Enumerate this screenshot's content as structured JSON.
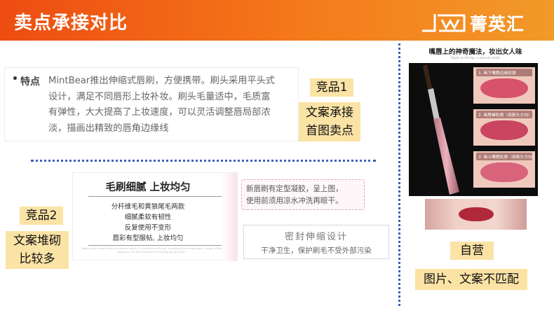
{
  "header": {
    "title": "卖点承接对比",
    "logo_text": "菁英汇",
    "accent": "#f06a18"
  },
  "competitor1": {
    "bullet": "•",
    "feature_label": "特点",
    "feature_lines": [
      "MintBear推出伸缩式唇刷，方便携带。刷头采用平头式",
      "设计，满足不同唇形上妆补妆。刷头毛量适中，毛质富",
      "有弹性，大大提高了上妆速度，可以灵活调整唇局部浓",
      "淡，描画出精致的唇角边缘线"
    ],
    "tag_name": "竞品1",
    "tag_desc_lines": [
      "文案承接",
      "首图卖点"
    ]
  },
  "competitor2": {
    "tag_name": "竞品2",
    "tag_desc_lines": [
      "文案堆砌",
      "比较多"
    ],
    "card_title": "毛刷细腻 上妆均匀",
    "card_items": [
      "分杆维毛和黄狼尾毛两款",
      "细腻柔软有韧性",
      "反复使用不变形",
      "唇彩有型服帖, 上妆均匀"
    ],
    "card_small_text": "Tooth is not a time of life or a state of mind; it is a tenure of the will, a quality of the imagination, a vigor of the emotions. It is the freshness of the deep spring of life.",
    "note_lines": [
      "新唇刷有定型凝胶，呈上图，",
      "使用前须用凉水冲洗再晾干。"
    ],
    "seal_title": "密封伸缩设计",
    "seal_sub": "干净卫生，保护刷毛不受外部污染"
  },
  "self": {
    "product_title": "嘴唇上的神奇魔法，妆出女人味",
    "product_sub": "Magic on the lips, a woman's taste",
    "steps": [
      "1. 画下嘴唇边缘轮廓",
      "2. 画唇峰轮廓（按箭头方向）",
      "3. 画上嘴唇轮廓（按箭头方向）"
    ],
    "tag_name": "自营",
    "tag_desc": "图片、文案不匹配"
  },
  "colors": {
    "tag_bg": "#fbe3a6",
    "divider": "#3d5fb8",
    "lip": "#c9344a"
  }
}
